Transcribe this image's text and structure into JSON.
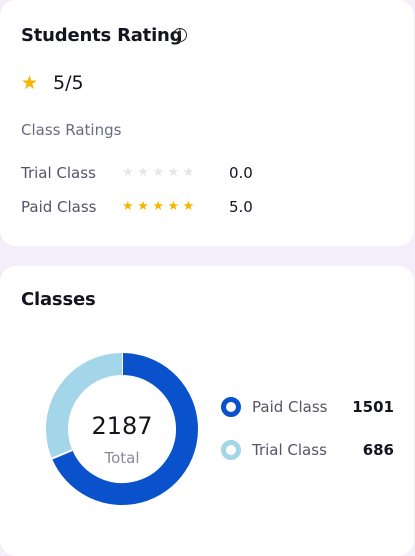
{
  "rating_card": {
    "title": "Students Rating",
    "info_icon": "info-icon",
    "overall_score": "5/5",
    "section_label": "Class Ratings",
    "star_color": "#f7b500",
    "empty_star_color": "#e6e6ea",
    "rows": [
      {
        "label": "Trial Class",
        "stars_filled": 0,
        "stars_total": 5,
        "value": "0.0"
      },
      {
        "label": "Paid Class",
        "stars_filled": 5,
        "stars_total": 5,
        "value": "5.0"
      }
    ]
  },
  "classes_card": {
    "title": "Classes",
    "total": "2187",
    "total_label": "Total",
    "segments": [
      {
        "label": "Paid Class",
        "value": 1501,
        "display": "1501",
        "color": "#0a52cc"
      },
      {
        "label": "Trial Class",
        "value": 686,
        "display": "686",
        "color": "#a3d6e8"
      }
    ]
  }
}
